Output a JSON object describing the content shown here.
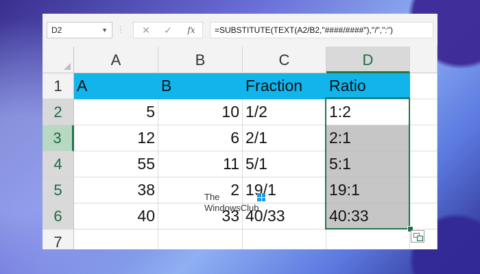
{
  "formula_bar": {
    "name_box": "D2",
    "fx_label": "fx",
    "cancel_glyph": "✕",
    "enter_glyph": "✓",
    "formula": "=SUBSTITUTE(TEXT(A2/B2,\"####/####\"),\"/\",\":\")"
  },
  "columns": [
    "A",
    "B",
    "C",
    "D"
  ],
  "rows": [
    "1",
    "2",
    "3",
    "4",
    "5",
    "6",
    "7"
  ],
  "header_row": [
    "A",
    "B",
    "Fraction",
    "Ratio"
  ],
  "data_rows": [
    [
      "5",
      "10",
      "1/2",
      "1:2"
    ],
    [
      "12",
      "6",
      "2/1",
      "2:1"
    ],
    [
      "55",
      "11",
      "5/1",
      "5:1"
    ],
    [
      "38",
      "2",
      "19/1",
      "19:1"
    ],
    [
      "40",
      "33",
      "40/33",
      "40:33"
    ]
  ],
  "watermark": {
    "line1": "The",
    "line2": "WindowsClub"
  },
  "colors": {
    "header_fill": "#11b5ec",
    "selection_green": "#217346",
    "selection_gray": "#c6c6c6"
  },
  "icons": [
    "chevron-down-icon",
    "cancel-icon",
    "enter-icon",
    "function-icon",
    "quick-analysis-icon",
    "windows-logo-icon"
  ]
}
